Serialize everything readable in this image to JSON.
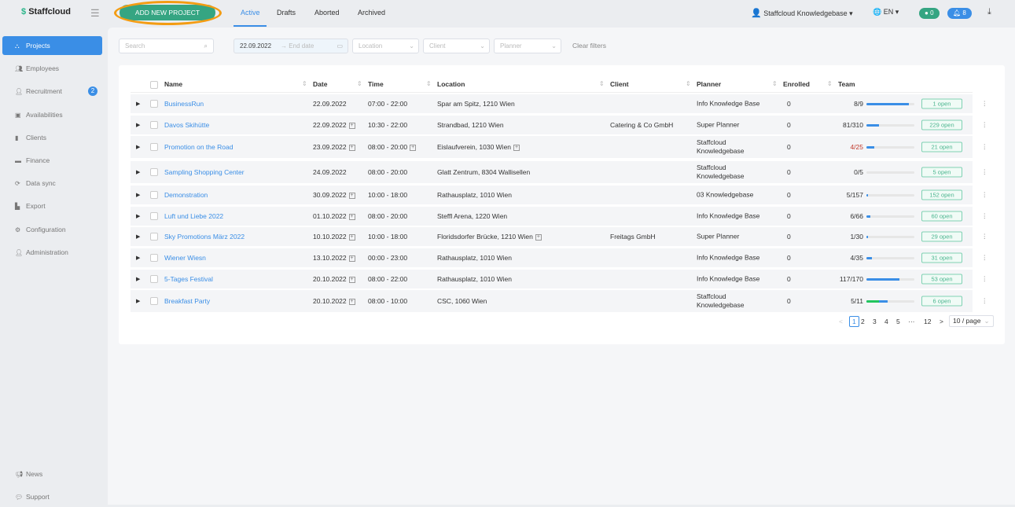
{
  "header": {
    "logo": "Staffcloud",
    "add_button": "ADD NEW PROJECT",
    "tabs": [
      "Active",
      "Drafts",
      "Aborted",
      "Archived"
    ],
    "active_tab": "Active",
    "user": "Staffcloud Knowledgebase",
    "language": "EN",
    "messages_count": "0",
    "notifications_count": "8",
    "accent": "#3a8ee6",
    "brand": "#35a582"
  },
  "sidebar": {
    "items": [
      {
        "label": "Projects",
        "icon": "sitemap-icon"
      },
      {
        "label": "Employees",
        "icon": "users-icon"
      },
      {
        "label": "Recruitment",
        "icon": "user-plus-icon",
        "badge": "2"
      },
      {
        "label": "Availabilities",
        "icon": "calendar-check-icon"
      },
      {
        "label": "Clients",
        "icon": "building-icon"
      },
      {
        "label": "Finance",
        "icon": "money-icon"
      },
      {
        "label": "Data sync",
        "icon": "sync-icon"
      },
      {
        "label": "Export",
        "icon": "file-icon"
      },
      {
        "label": "Configuration",
        "icon": "gear-icon"
      },
      {
        "label": "Administration",
        "icon": "user-gear-icon"
      }
    ],
    "bottom": [
      {
        "label": "News",
        "icon": "megaphone-icon"
      },
      {
        "label": "Support",
        "icon": "support-icon"
      }
    ]
  },
  "filters": {
    "search_placeholder": "Search",
    "start_date": "22.09.2022",
    "end_date_placeholder": "End date",
    "location_placeholder": "Location",
    "client_placeholder": "Client",
    "planner_placeholder": "Planner",
    "clear": "Clear filters"
  },
  "table": {
    "columns": [
      "Name",
      "Date",
      "Time",
      "Location",
      "Client",
      "Planner",
      "Enrolled",
      "Team"
    ],
    "rows": [
      {
        "name": "BusinessRun",
        "date": "22.09.2022",
        "date_plus": false,
        "time": "07:00 - 22:00",
        "time_plus": false,
        "location": "Spar am Spitz, 1210 Wien",
        "loc_plus": false,
        "client": "",
        "planner": "Info Knowledge Base",
        "enrolled": "0",
        "team": "8/9",
        "fraction": 0.89,
        "confirmed": 0,
        "open": "1 open"
      },
      {
        "name": "Davos Skihütte",
        "date": "22.09.2022",
        "date_plus": true,
        "time": "10:30 - 22:00",
        "time_plus": false,
        "location": "Strandbad, 1210 Wien",
        "loc_plus": false,
        "client": "Catering & Co GmbH",
        "planner": "Super Planner",
        "enrolled": "0",
        "team": "81/310",
        "fraction": 0.26,
        "confirmed": 0,
        "open": "229 open"
      },
      {
        "name": "Promotion on the Road",
        "date": "23.09.2022",
        "date_plus": true,
        "time": "08:00 - 20:00",
        "time_plus": true,
        "location": "Eislaufverein, 1030 Wien",
        "loc_plus": true,
        "client": "",
        "planner": "Staffcloud Knowledgebase",
        "enrolled": "0",
        "team": "4/25",
        "team_alert": true,
        "fraction": 0.16,
        "confirmed": 0,
        "open": "21 open"
      },
      {
        "name": "Sampling Shopping Center",
        "date": "24.09.2022",
        "date_plus": false,
        "time": "08:00 - 20:00",
        "time_plus": false,
        "location": "Glatt Zentrum, 8304 Wallisellen",
        "loc_plus": false,
        "client": "",
        "planner": "Staffcloud Knowledgebase",
        "enrolled": "0",
        "team": "0/5",
        "fraction": 0,
        "confirmed": 0,
        "open": "5 open"
      },
      {
        "name": "Demonstration",
        "date": "30.09.2022",
        "date_plus": true,
        "time": "10:00 - 18:00",
        "time_plus": false,
        "location": "Rathausplatz, 1010 Wien",
        "loc_plus": false,
        "client": "",
        "planner": "03 Knowledgebase",
        "enrolled": "0",
        "team": "5/157",
        "fraction": 0.03,
        "confirmed": 0,
        "open": "152 open"
      },
      {
        "name": "Luft und Liebe 2022",
        "date": "01.10.2022",
        "date_plus": true,
        "time": "08:00 - 20:00",
        "time_plus": false,
        "location": "Steffl Arena, 1220 Wien",
        "loc_plus": false,
        "client": "",
        "planner": "Info Knowledge Base",
        "enrolled": "0",
        "team": "6/66",
        "fraction": 0.09,
        "confirmed": 0,
        "open": "60 open"
      },
      {
        "name": "Sky Promotions März 2022",
        "date": "10.10.2022",
        "date_plus": true,
        "time": "10:00 - 18:00",
        "time_plus": false,
        "location": "Floridsdorfer Brücke, 1210 Wien",
        "loc_plus": true,
        "client": "Freitags GmbH",
        "planner": "Super Planner",
        "enrolled": "0",
        "team": "1/30",
        "fraction": 0.03,
        "confirmed": 0,
        "open": "29 open"
      },
      {
        "name": "Wiener Wiesn",
        "date": "13.10.2022",
        "date_plus": true,
        "time": "00:00 - 23:00",
        "time_plus": false,
        "location": "Rathausplatz, 1010 Wien",
        "loc_plus": false,
        "client": "",
        "planner": "Info Knowledge Base",
        "enrolled": "0",
        "team": "4/35",
        "fraction": 0.11,
        "confirmed": 0,
        "open": "31 open"
      },
      {
        "name": "5-Tages Festival",
        "date": "20.10.2022",
        "date_plus": true,
        "time": "08:00 - 22:00",
        "time_plus": false,
        "location": "Rathausplatz, 1010 Wien",
        "loc_plus": false,
        "client": "",
        "planner": "Info Knowledge Base",
        "enrolled": "0",
        "team": "117/170",
        "fraction": 0.69,
        "confirmed": 0,
        "open": "53 open"
      },
      {
        "name": "Breakfast Party",
        "date": "20.10.2022",
        "date_plus": true,
        "time": "08:00 - 10:00",
        "time_plus": false,
        "location": "CSC, 1060 Wien",
        "loc_plus": false,
        "client": "",
        "planner": "Staffcloud Knowledgebase",
        "enrolled": "0",
        "team": "5/11",
        "fraction": 0.45,
        "confirmed": 0.27,
        "open": "6 open"
      }
    ]
  },
  "pagination": {
    "pages": [
      "1",
      "2",
      "3",
      "4",
      "5",
      "···",
      "12"
    ],
    "current": "1",
    "page_size": "10 / page"
  }
}
